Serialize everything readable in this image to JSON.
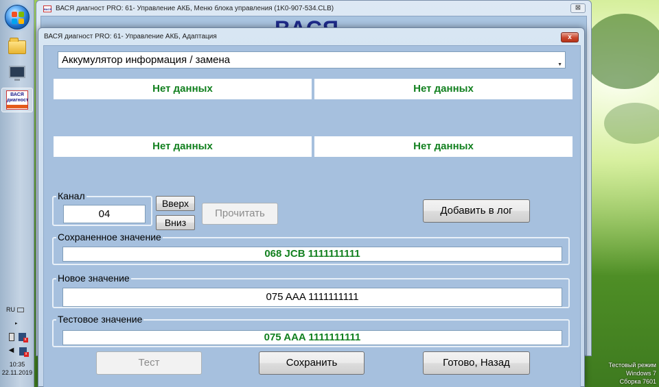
{
  "desktop": {
    "watermark": {
      "line1": "Тестовый режим",
      "line2": "Windows 7",
      "line3": "Сборка 7601"
    }
  },
  "taskbar": {
    "language": "RU",
    "clock": {
      "time": "10:35",
      "date": "22.11.2019"
    }
  },
  "background_window": {
    "title": "ВАСЯ диагност PRO: 61- Управление АКБ,  Меню блока управления (1K0-907-534.CLB)",
    "brand": "ВАСЯ",
    "close_label": "⊠"
  },
  "dialog": {
    "title": "ВАСЯ диагност PRO: 61- Управление АКБ, Адаптация",
    "close_label": "x",
    "selector": {
      "selected": "Аккумулятор информация / замена"
    },
    "info_cells": [
      "Нет данных",
      "Нет данных",
      "Нет данных",
      "Нет данных"
    ],
    "channel": {
      "legend": "Канал",
      "value": "04",
      "up_label": "Вверх",
      "down_label": "Вниз",
      "read_label": "Прочитать"
    },
    "add_log_label": "Добавить в лог",
    "saved": {
      "legend": "Сохраненное значение",
      "value": "068 JCB 1111111111"
    },
    "new": {
      "legend": "Новое значение",
      "value": "075 AAA 1111111111"
    },
    "test": {
      "legend": "Тестовое значение",
      "value": "075 AAA 1111111111"
    },
    "buttons": {
      "test": "Тест",
      "save": "Сохранить",
      "done": "Готово, Назад"
    }
  }
}
